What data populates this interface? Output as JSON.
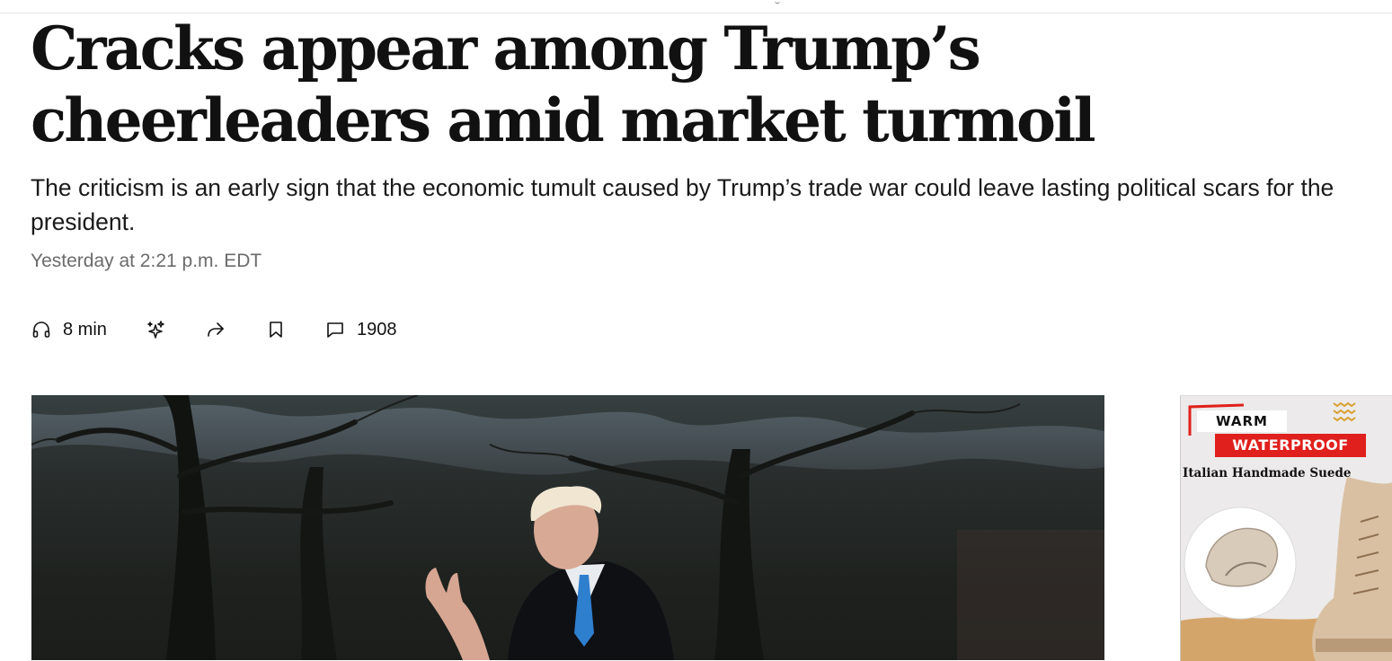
{
  "article": {
    "headline": "Cracks appear among Trump’s cheerleaders amid market turmoil",
    "dek": "The criticism is an early sign that the economic tumult caused by Trump’s trade war could leave lasting political scars for the president.",
    "timestamp": "Yesterday at 2:21 p.m. EDT"
  },
  "toolbar": {
    "listen": {
      "icon": "headphones-icon",
      "label": "8 min"
    },
    "ai_summary": {
      "icon": "sparkle-icon"
    },
    "share": {
      "icon": "share-arrow-icon"
    },
    "save": {
      "icon": "bookmark-icon"
    },
    "comments": {
      "icon": "comment-icon",
      "count": "1908"
    }
  },
  "ad": {
    "line1": "WARM",
    "line2": "WATERPROOF",
    "line3": "Italian Handmade Suede",
    "accent_color": "#e0201c"
  },
  "colors": {
    "text": "#111111",
    "muted": "#6b6b6b"
  }
}
